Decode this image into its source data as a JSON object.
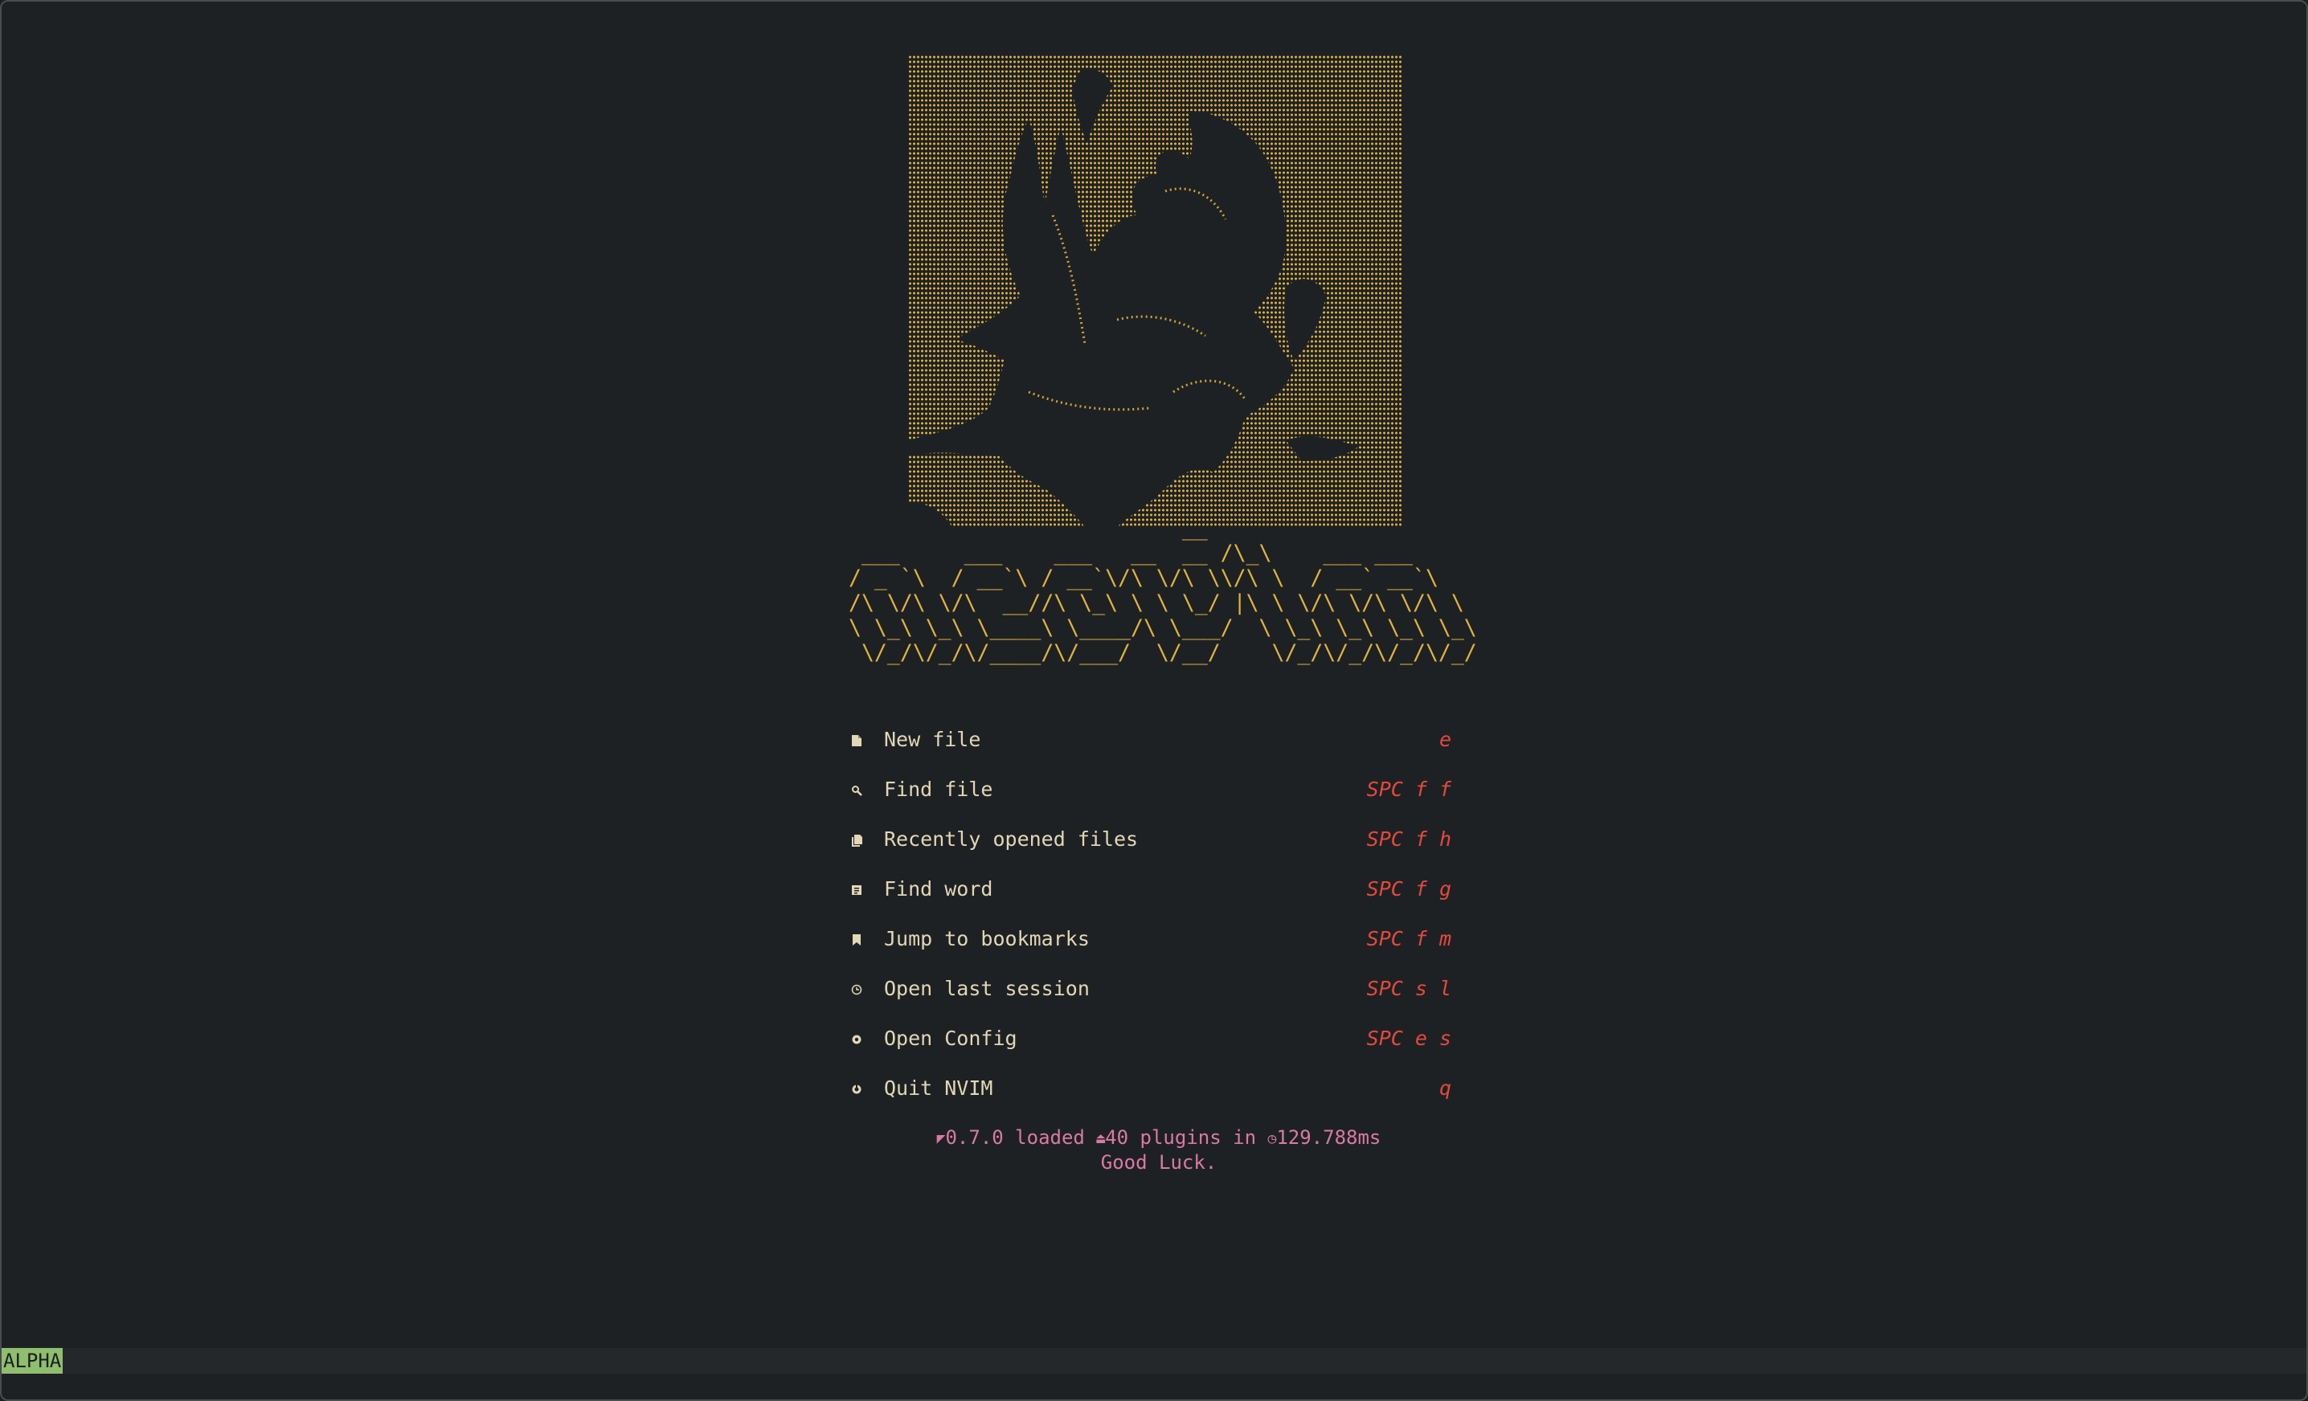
{
  "banner_lines": [
    "                          __",
    " ___     ___    ___   __  __ /\\_\\    ___ ___",
    "/ _ `\\  / __`\\ / __`\\/\\ \\/\\ \\\\/\\ \\  / __` __`\\",
    "/\\ \\/\\ \\/\\  __//\\ \\_\\ \\ \\ \\_/ |\\ \\ \\/\\ \\/\\ \\/\\ \\",
    "\\ \\_\\ \\_\\ \\____\\ \\____/\\ \\___/  \\ \\_\\ \\_\\ \\_\\ \\_\\",
    " \\/_/\\/_/\\/____/\\/___/  \\/__/    \\/_/\\/_/\\/_/\\/_/"
  ],
  "menu": [
    {
      "label": "New file",
      "key": "e",
      "icon": "file-icon"
    },
    {
      "label": "Find file",
      "key": "SPC f f",
      "icon": "search-icon"
    },
    {
      "label": "Recently opened files",
      "key": "SPC f h",
      "icon": "files-icon"
    },
    {
      "label": "Find word",
      "key": "SPC f g",
      "icon": "word-icon"
    },
    {
      "label": "Jump to bookmarks",
      "key": "SPC f m",
      "icon": "bookmark-icon"
    },
    {
      "label": "Open last session",
      "key": "SPC s l",
      "icon": "clock-icon"
    },
    {
      "label": "Open Config",
      "key": "SPC e s",
      "icon": "gear-icon"
    },
    {
      "label": "Quit NVIM",
      "key": "q",
      "icon": "power-icon"
    }
  ],
  "footer": {
    "version": "0.7.0",
    "loaded_text": "loaded",
    "plugin_count": "40",
    "plugins_text": "plugins in",
    "load_time": "129.788ms",
    "tagline": "Good Luck."
  },
  "statusline": {
    "mode": "ALPHA"
  },
  "colors": {
    "background": "#1e2124",
    "art": "#e0b33f",
    "menu_text": "#e2d7b6",
    "shortcut": "#e5493e",
    "footer": "#d97aa3",
    "mode_bg": "#8fbe6e"
  }
}
